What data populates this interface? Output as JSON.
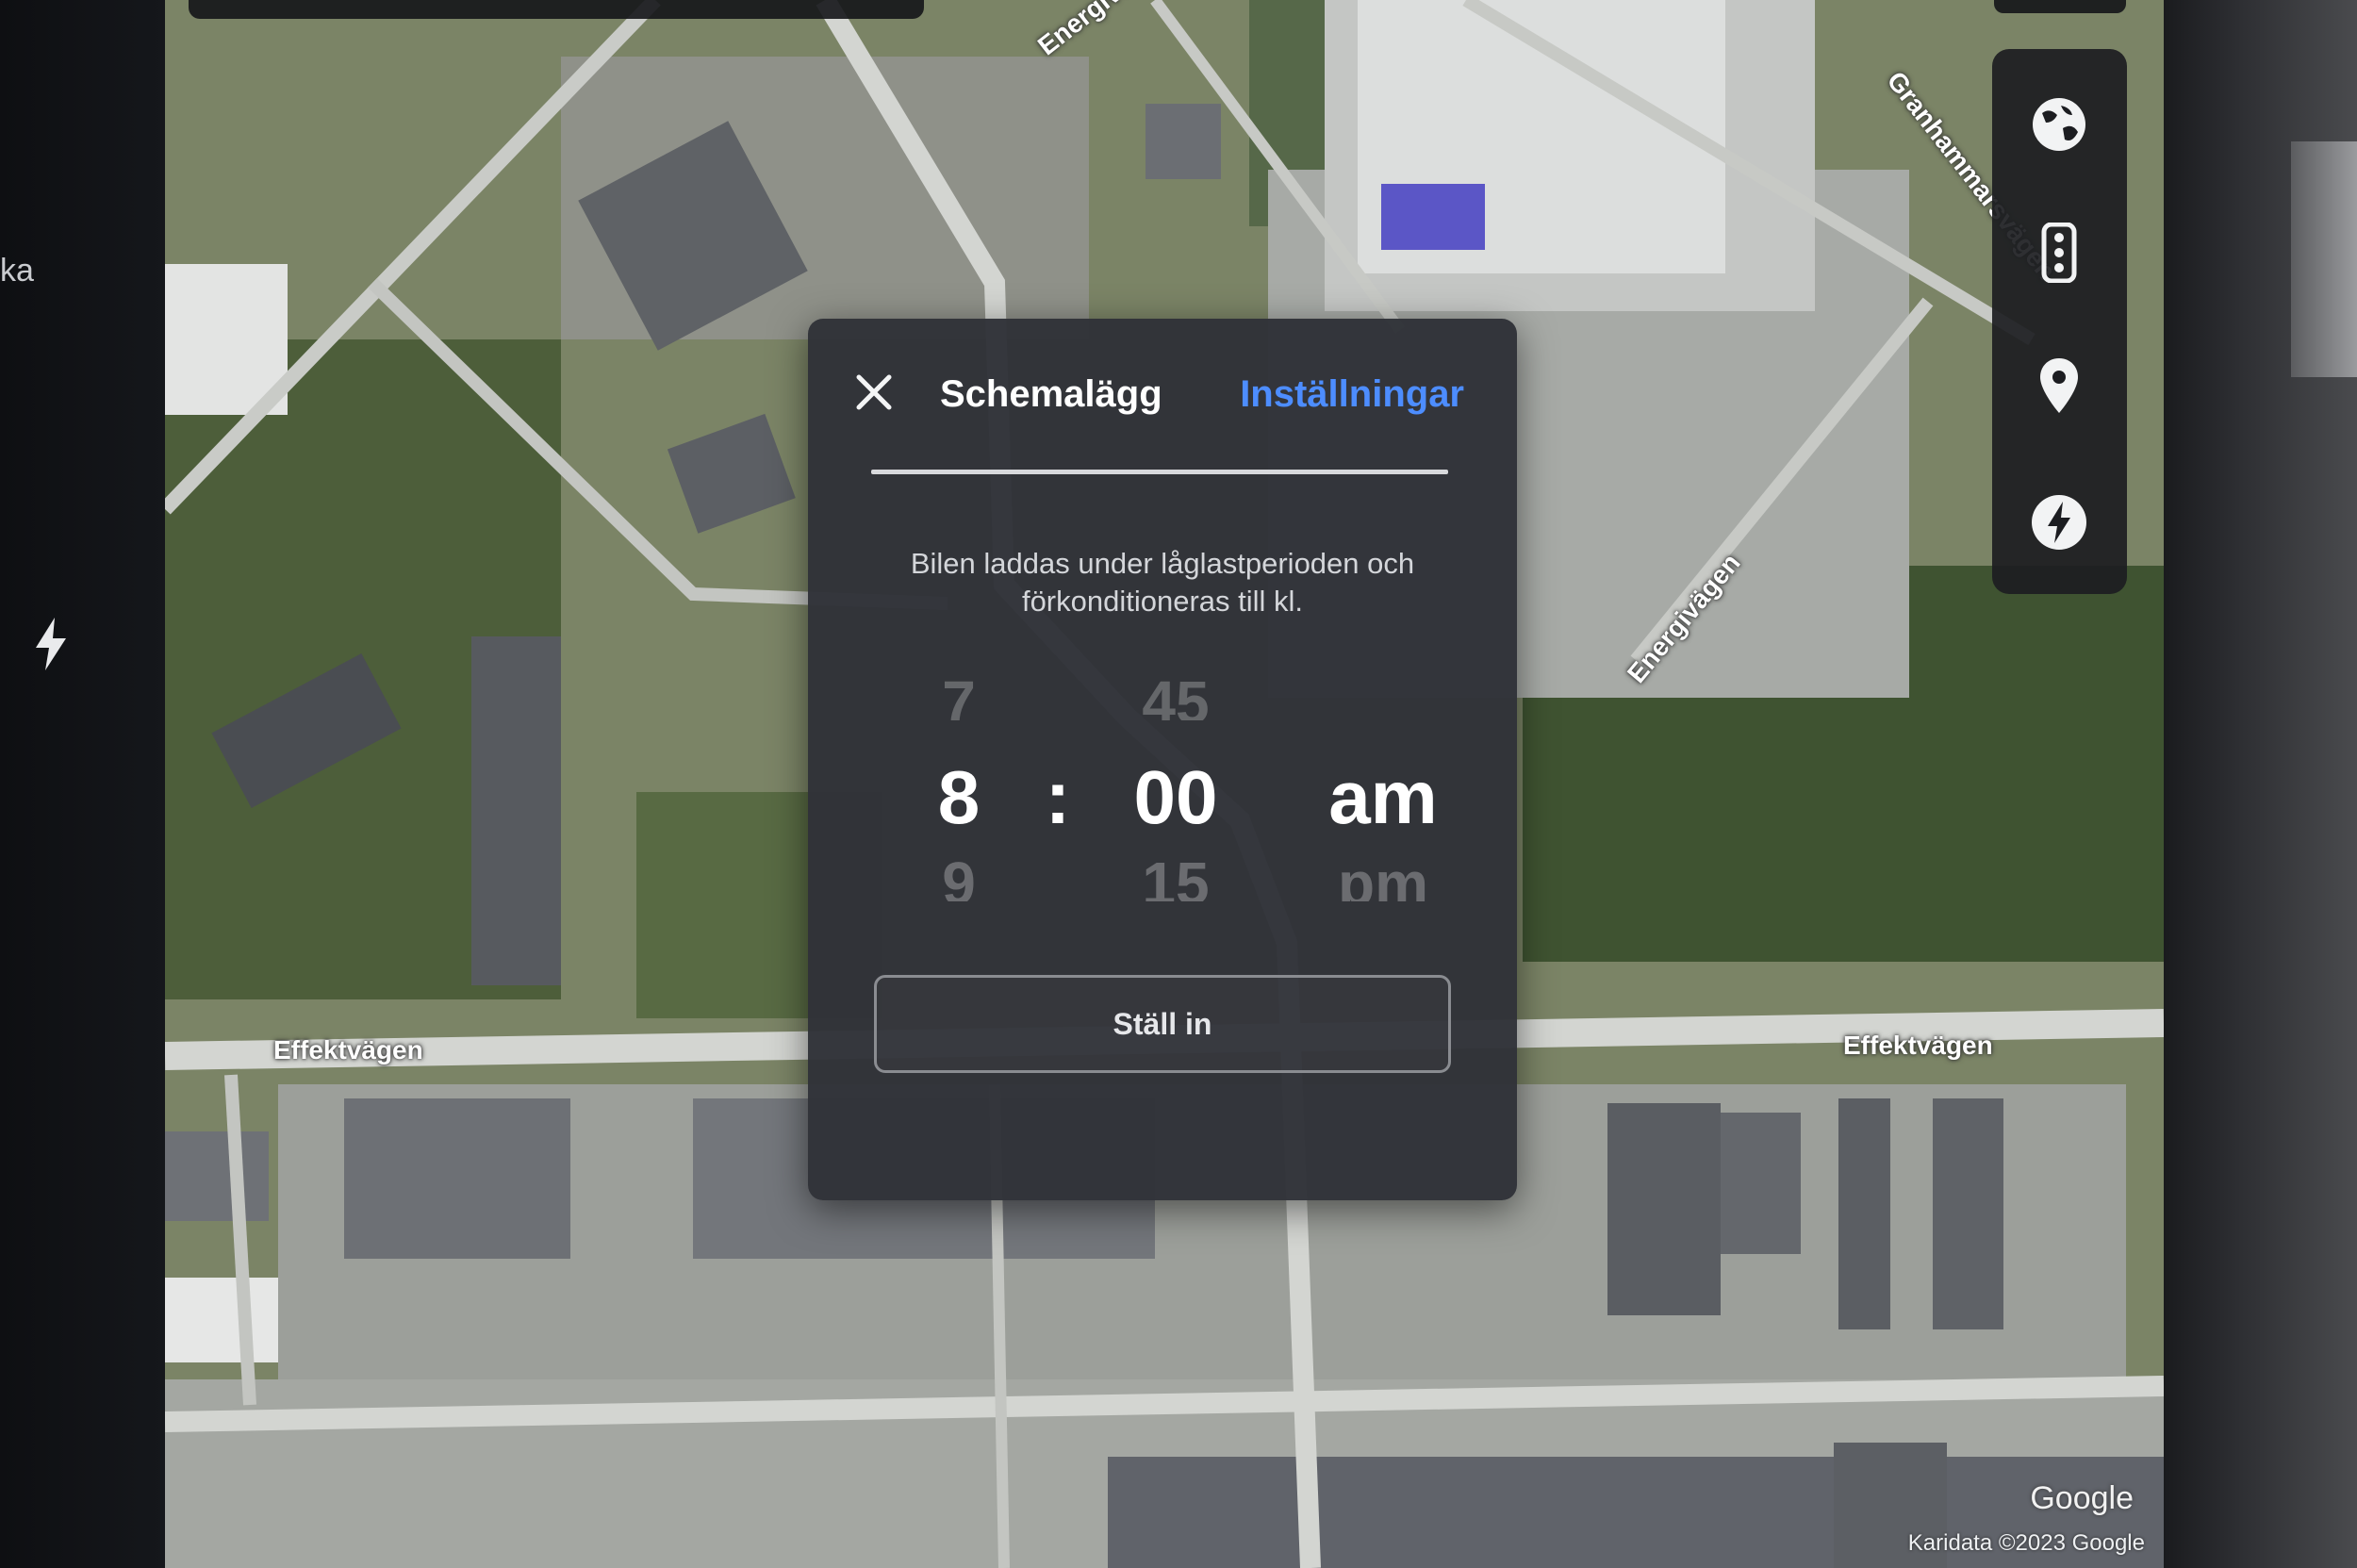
{
  "left_panel": {
    "text": "ka"
  },
  "map": {
    "road_labels": {
      "energivagen_top": "Energivägen",
      "energivagen_mid": "Energivägen",
      "granhammarsvagen": "Granhammarsvägen",
      "effektvagen_left": "Effektvägen",
      "effektvagen_right": "Effektvägen"
    },
    "google_logo": "Google",
    "attribution": "Karidata ©2023 Google"
  },
  "map_controls": {
    "items": [
      {
        "icon": "globe-icon"
      },
      {
        "icon": "traffic-light-icon"
      },
      {
        "icon": "location-pin-icon"
      },
      {
        "icon": "charging-bolt-icon"
      }
    ]
  },
  "dialog": {
    "title": "Schemalägg",
    "settings_link": "Inställningar",
    "description": "Bilen laddas under låglastperioden och förkonditioneras till kl.",
    "picker": {
      "hour_prev": "7",
      "hour": "8",
      "hour_next": "9",
      "separator": ":",
      "minute_prev": "45",
      "minute": "00",
      "minute_next": "15",
      "period": "am",
      "period_next": "pm"
    },
    "set_button": "Ställ in"
  },
  "colors": {
    "accent": "#4d8dff",
    "dialog_bg": "#303238",
    "panel_bg": "#1c1d21"
  }
}
